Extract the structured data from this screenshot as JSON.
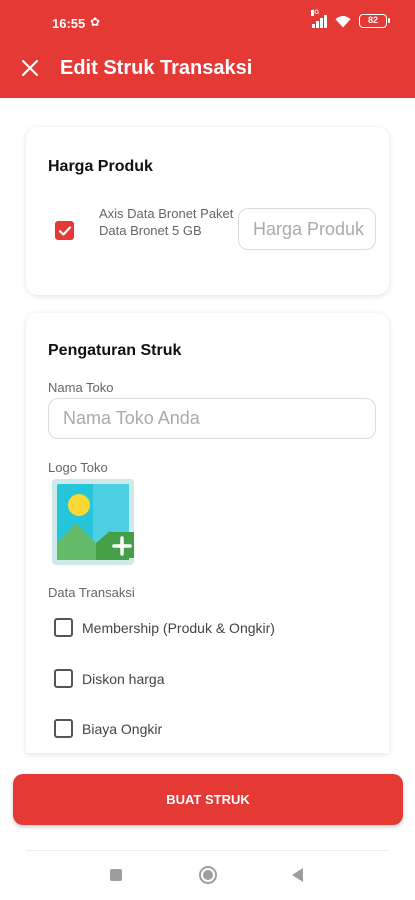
{
  "status_bar": {
    "time": "16:55",
    "signal_badge": "4G",
    "battery": "82"
  },
  "app_bar": {
    "title": "Edit Struk Transaksi",
    "close_icon": "close-icon"
  },
  "harga_produk": {
    "title": "Harga Produk",
    "product": {
      "name": "Axis Data Bronet Paket Data Bronet 5 GB",
      "checked": true,
      "price_placeholder": "Harga Produk",
      "price_value": ""
    }
  },
  "pengaturan_struk": {
    "title": "Pengaturan Struk",
    "nama_toko_label": "Nama Toko",
    "nama_toko_placeholder": "Nama Toko Anda",
    "nama_toko_value": "",
    "logo_label": "Logo Toko",
    "logo_icon": "add-image-icon",
    "data_transaksi_label": "Data Transaksi",
    "options": [
      {
        "label": "Membership (Produk & Ongkir)",
        "checked": false
      },
      {
        "label": "Diskon harga",
        "checked": false
      },
      {
        "label": "Biaya Ongkir",
        "checked": false
      }
    ]
  },
  "actions": {
    "submit_label": "BUAT STRUK"
  },
  "colors": {
    "primary": "#e53935",
    "logo_tile": "#cfe8ea",
    "logo_sun": "#fdd835",
    "logo_hill": "#66bb6a",
    "logo_sky": "#26c6da"
  },
  "nav_bar": {
    "recents_icon": "square-icon",
    "home_icon": "circle-icon",
    "back_icon": "triangle-back-icon"
  }
}
